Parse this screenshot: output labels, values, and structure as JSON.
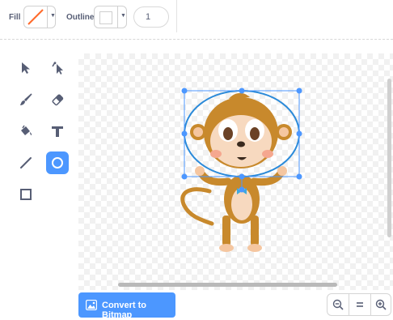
{
  "toolbar": {
    "fill_label": "Fill",
    "fill_color": "#ff6a2a",
    "outline_label": "Outline",
    "outline_color": "#ffffff",
    "stroke_width": "1"
  },
  "tools": [
    {
      "name": "select-tool",
      "icon": "arrow-icon",
      "active": false
    },
    {
      "name": "reshape-tool",
      "icon": "reshape-icon",
      "active": false
    },
    {
      "name": "brush-tool",
      "icon": "brush-icon",
      "active": false
    },
    {
      "name": "eraser-tool",
      "icon": "eraser-icon",
      "active": false
    },
    {
      "name": "fill-tool",
      "icon": "bucket-icon",
      "active": false
    },
    {
      "name": "text-tool",
      "icon": "text-icon",
      "active": false
    },
    {
      "name": "line-tool",
      "icon": "line-icon",
      "active": false
    },
    {
      "name": "circle-tool",
      "icon": "circle-icon",
      "active": true
    },
    {
      "name": "rectangle-tool",
      "icon": "square-icon",
      "active": false
    }
  ],
  "canvas": {
    "sprite": "monkey"
  },
  "bottom": {
    "convert_label": "Convert to Bitmap"
  },
  "colors": {
    "accent": "#4c97ff",
    "selection": "#2b8ad9"
  }
}
